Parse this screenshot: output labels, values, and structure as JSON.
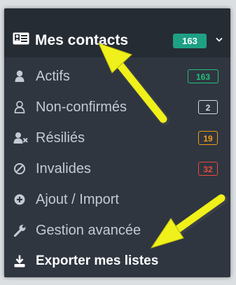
{
  "header": {
    "title": "Mes contacts",
    "badge": "163",
    "icon": "contact-card-icon",
    "chevron_icon": "chevron-down-icon"
  },
  "menu": {
    "items": [
      {
        "label": "Actifs",
        "icon": "user-icon",
        "badge": "163",
        "badge_color": "#23c17a"
      },
      {
        "label": "Non-confirmés",
        "icon": "user-outline-icon",
        "badge": "2",
        "badge_color": "#d6dbe0"
      },
      {
        "label": "Résiliés",
        "icon": "user-remove-icon",
        "badge": "19",
        "badge_color": "#f39c12"
      },
      {
        "label": "Invalides",
        "icon": "ban-icon",
        "badge": "32",
        "badge_color": "#e74c3c"
      },
      {
        "label": "Ajout / Import",
        "icon": "plus-circle-icon"
      },
      {
        "label": "Gestion avancée",
        "icon": "wrench-icon"
      },
      {
        "label": "Exporter mes listes",
        "icon": "download-icon"
      }
    ]
  },
  "colors": {
    "panel_bg": "#2f3640",
    "header_bg": "#262c33",
    "header_badge_bg": "#1ea084",
    "arrow": "#f0f01a"
  }
}
